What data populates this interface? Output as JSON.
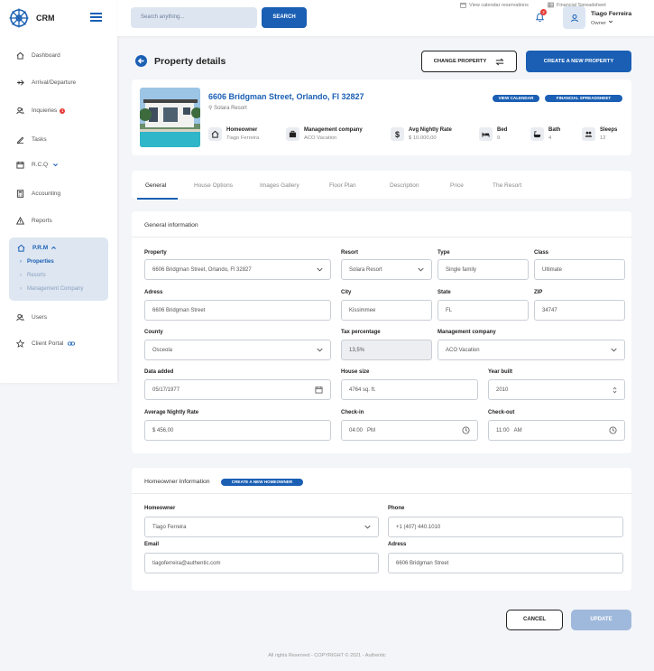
{
  "app": {
    "brand": "CRM"
  },
  "sidebar": {
    "items": [
      {
        "label": "Dashboard",
        "icon": "home-icon"
      },
      {
        "label": "Arrival/Departure",
        "icon": "plane-icon"
      },
      {
        "label": "Inquieries",
        "icon": "users-icon",
        "badge": "1"
      },
      {
        "label": "Tasks",
        "icon": "pencil-icon"
      },
      {
        "label": "R.C.Q",
        "icon": "calendar-icon"
      },
      {
        "label": "Accounting",
        "icon": "calculator-icon"
      },
      {
        "label": "Reports",
        "icon": "warning-icon"
      },
      {
        "label": "P.R.M",
        "icon": "home-icon"
      },
      {
        "label": "Users",
        "icon": "users-icon"
      },
      {
        "label": "Client Portal",
        "icon": "star-icon"
      }
    ],
    "prm_sub": [
      "Properties",
      "Resorts",
      "Management Company"
    ]
  },
  "topbar": {
    "search_placeholder": "Search anything...",
    "search_button": "SEARCH",
    "link_calendar": "View calendar reservations",
    "link_financial": "Financial Spreadsheet",
    "notifications": "2",
    "user_name": "Tiago Ferreira",
    "user_role": "Owner"
  },
  "header": {
    "title": "Property details",
    "change_property": "CHANGE PROPERTY",
    "create_property": "CREATE A NEW PROPERTY"
  },
  "property": {
    "address": "6606 Bridgman Street, Orlando, Fl 32827",
    "resort": "Solara Resort",
    "view_calendar": "VIEW CALENDAR",
    "financial_spreadsheet": "FINANCIAL SPREADSHEET",
    "stats": [
      {
        "label": "Homeowner",
        "value": "Tiago Ferreira",
        "icon": "home-icon"
      },
      {
        "label": "Management company",
        "value": "ACO Vacation",
        "icon": "briefcase-icon"
      },
      {
        "label": "Avg Nightly Rate",
        "value": "$ 10.000,00",
        "icon": "dollar-icon"
      },
      {
        "label": "Bed",
        "value": "9",
        "icon": "bed-icon"
      },
      {
        "label": "Bath",
        "value": "4",
        "icon": "bath-icon"
      },
      {
        "label": "Sleeps",
        "value": "12",
        "icon": "people-icon"
      }
    ]
  },
  "tabs": [
    "General",
    "House Options",
    "Images Gallery",
    "Floor Plan",
    "Description",
    "Price",
    "The Resort"
  ],
  "general": {
    "title": "General information",
    "fields": {
      "property": {
        "label": "Property",
        "value": "6606 Bridgman Street, Orlando, Fl 32827"
      },
      "resort": {
        "label": "Resort",
        "value": "Solara Resort"
      },
      "type": {
        "label": "Type",
        "value": "Single family"
      },
      "class": {
        "label": "Class",
        "value": "Ultimate"
      },
      "adress": {
        "label": "Adress",
        "value": "6606 Bridgman Street"
      },
      "city": {
        "label": "City",
        "value": "Kissimmee"
      },
      "state": {
        "label": "State",
        "value": "FL"
      },
      "zip": {
        "label": "ZIP",
        "value": "34747"
      },
      "county": {
        "label": "County",
        "value": "Osceola"
      },
      "tax": {
        "label": "Tax percentage",
        "value": "13,5%"
      },
      "mgmt": {
        "label": "Management company",
        "value": "ACO Vacation"
      },
      "date_added": {
        "label": "Data added",
        "value": "05/17/1977"
      },
      "house_size": {
        "label": "House size",
        "value": "4764 sq. ft."
      },
      "year_built": {
        "label": "Year built",
        "value": "2010"
      },
      "avg_rate": {
        "label": "Average Nightly Rate",
        "value": "$ 456,00"
      },
      "checkin": {
        "label": "Check-in",
        "value": "04:00",
        "ampm": "PM"
      },
      "checkout": {
        "label": "Check-out",
        "value": "11:00",
        "ampm": "AM"
      }
    }
  },
  "homeowner": {
    "title": "Homeowner Information",
    "create_button": "CREATE A NEW HOMEOWNER",
    "homeowner": {
      "label": "Homeowner",
      "value": "Tiago Ferreira"
    },
    "phone": {
      "label": "Phone",
      "value": "+1 (407) 440.1010"
    },
    "email": {
      "label": "Email",
      "value": "tiagoferreira@authentic.com"
    },
    "adress": {
      "label": "Adress",
      "value": "6606 Bridgman Street"
    }
  },
  "actions": {
    "cancel": "CANCEL",
    "update": "UPDATE"
  },
  "footer": "All rights Reserved - COPYRIGHT © 2021 - Authentic",
  "colors": {
    "accent": "#1a5fb4",
    "badge": "#e53935",
    "update_disabled": "#9fb9dc"
  }
}
